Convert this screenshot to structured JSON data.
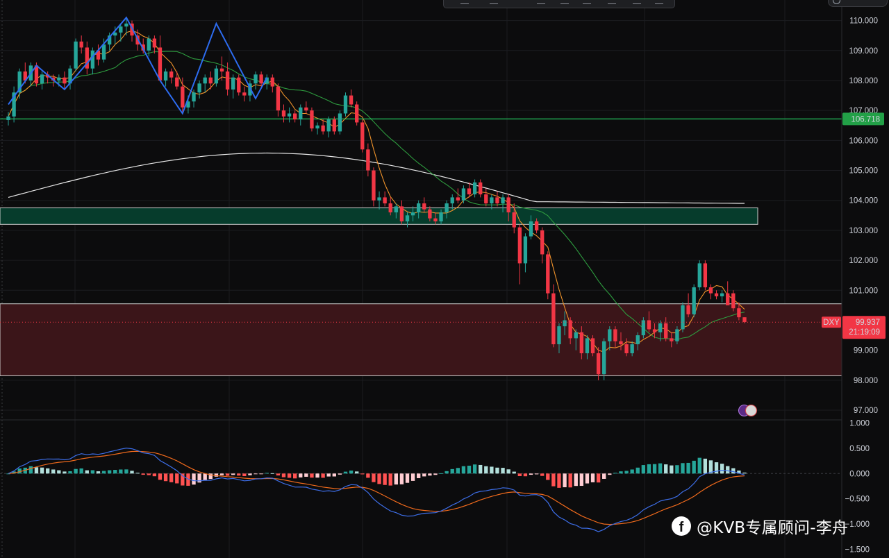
{
  "chart_data": [
    {
      "type": "candlestick",
      "symbol": "DXY",
      "ylim": [
        96.7,
        110.5
      ],
      "y_ticks": [
        "110.000",
        "109.000",
        "108.000",
        "107.000",
        "106.000",
        "105.000",
        "104.000",
        "103.000",
        "102.000",
        "101.000",
        "100.000",
        "99.000",
        "98.000",
        "97.000"
      ],
      "last_price": "99.937",
      "countdown": "21:19:09",
      "horizontal_line": {
        "value": 106.718,
        "label": "106.718",
        "color": "#22c55e"
      },
      "zones": [
        {
          "name": "support-zone",
          "from": 103.2,
          "to": 103.75,
          "fill": "#063c2c",
          "border": "#d0d0d0"
        },
        {
          "name": "resistance-zone",
          "from": 98.15,
          "to": 100.55,
          "fill": "#3b1519",
          "border": "#d0d0d0"
        }
      ],
      "colors": {
        "up": "#26a69a",
        "down": "#f23645",
        "ma_fast": "#f0932b",
        "ma_mid": "#2e9c3f",
        "ma_slow": "#e8e8e8",
        "zigzag": "#2d6cf0"
      },
      "candles": [
        [
          106.68,
          106.95,
          106.5,
          106.8
        ],
        [
          106.8,
          107.8,
          106.6,
          107.6
        ],
        [
          107.6,
          108.4,
          107.4,
          108.3
        ],
        [
          108.3,
          108.6,
          107.9,
          108.0
        ],
        [
          108.0,
          108.6,
          107.8,
          108.5
        ],
        [
          108.5,
          108.6,
          107.8,
          107.9
        ],
        [
          107.9,
          108.3,
          107.7,
          108.2
        ],
        [
          108.2,
          108.3,
          107.9,
          108.1
        ],
        [
          108.1,
          108.2,
          107.8,
          108.0
        ],
        [
          108.0,
          108.2,
          107.8,
          108.1
        ],
        [
          108.1,
          108.3,
          107.7,
          107.9
        ],
        [
          107.9,
          108.5,
          107.7,
          108.4
        ],
        [
          108.4,
          109.4,
          108.3,
          109.3
        ],
        [
          109.3,
          109.5,
          108.9,
          109.1
        ],
        [
          109.1,
          109.3,
          108.2,
          108.4
        ],
        [
          108.4,
          109.1,
          108.2,
          109.0
        ],
        [
          109.0,
          109.2,
          108.5,
          108.7
        ],
        [
          108.7,
          109.4,
          108.6,
          109.2
        ],
        [
          109.2,
          109.6,
          109.0,
          109.5
        ],
        [
          109.5,
          109.8,
          109.2,
          109.6
        ],
        [
          109.6,
          109.9,
          109.3,
          109.8
        ],
        [
          109.8,
          110.1,
          109.5,
          109.9
        ],
        [
          109.9,
          110.0,
          109.3,
          109.5
        ],
        [
          109.5,
          109.7,
          109.0,
          109.2
        ],
        [
          109.2,
          109.4,
          108.9,
          109.0
        ],
        [
          109.0,
          109.5,
          108.8,
          109.4
        ],
        [
          109.4,
          109.5,
          108.9,
          109.1
        ],
        [
          109.1,
          109.5,
          108.0,
          108.0
        ],
        [
          108.0,
          108.4,
          107.8,
          108.3
        ],
        [
          108.3,
          108.4,
          107.9,
          108.1
        ],
        [
          108.1,
          108.3,
          107.7,
          107.8
        ],
        [
          107.8,
          108.1,
          106.9,
          107.1
        ],
        [
          107.1,
          107.5,
          106.9,
          107.3
        ],
        [
          107.3,
          107.7,
          107.1,
          107.6
        ],
        [
          107.6,
          108.0,
          107.4,
          107.9
        ],
        [
          107.9,
          108.2,
          107.6,
          108.1
        ],
        [
          108.1,
          108.3,
          107.7,
          107.9
        ],
        [
          107.9,
          108.5,
          107.8,
          108.4
        ],
        [
          108.4,
          108.8,
          108.0,
          108.3
        ],
        [
          108.3,
          108.6,
          107.5,
          107.7
        ],
        [
          107.7,
          108.2,
          107.4,
          108.1
        ],
        [
          108.1,
          108.2,
          107.5,
          107.6
        ],
        [
          107.6,
          107.8,
          107.3,
          107.5
        ],
        [
          107.5,
          108.0,
          107.3,
          107.9
        ],
        [
          107.9,
          108.3,
          107.7,
          108.2
        ],
        [
          108.2,
          108.3,
          107.8,
          107.9
        ],
        [
          107.9,
          108.2,
          107.7,
          108.1
        ],
        [
          108.1,
          108.2,
          107.6,
          107.8
        ],
        [
          107.8,
          107.9,
          106.8,
          107.0
        ],
        [
          107.0,
          107.2,
          106.6,
          106.8
        ],
        [
          106.8,
          107.1,
          106.6,
          106.9
        ],
        [
          106.9,
          107.0,
          106.6,
          106.7
        ],
        [
          106.7,
          107.2,
          106.5,
          107.1
        ],
        [
          107.1,
          107.3,
          106.9,
          107.0
        ],
        [
          107.0,
          107.1,
          106.3,
          106.4
        ],
        [
          106.4,
          106.6,
          106.2,
          106.5
        ],
        [
          106.5,
          106.7,
          106.2,
          106.3
        ],
        [
          106.3,
          106.8,
          106.1,
          106.7
        ],
        [
          106.7,
          106.8,
          106.2,
          106.3
        ],
        [
          106.3,
          107.0,
          106.2,
          106.9
        ],
        [
          106.9,
          107.6,
          106.8,
          107.5
        ],
        [
          107.5,
          107.7,
          107.1,
          107.2
        ],
        [
          107.2,
          107.3,
          106.5,
          106.6
        ],
        [
          106.6,
          106.7,
          105.6,
          105.7
        ],
        [
          105.7,
          105.9,
          104.8,
          105.0
        ],
        [
          105.0,
          105.1,
          103.8,
          104.0
        ],
        [
          104.0,
          104.3,
          103.7,
          104.1
        ],
        [
          104.1,
          104.3,
          103.8,
          103.9
        ],
        [
          103.9,
          104.1,
          103.5,
          103.6
        ],
        [
          103.6,
          103.9,
          103.4,
          103.8
        ],
        [
          103.8,
          104.0,
          103.2,
          103.3
        ],
        [
          103.3,
          103.6,
          103.1,
          103.5
        ],
        [
          103.5,
          103.8,
          103.3,
          103.6
        ],
        [
          103.6,
          104.0,
          103.4,
          103.9
        ],
        [
          103.9,
          104.1,
          103.6,
          103.7
        ],
        [
          103.7,
          103.8,
          103.3,
          103.4
        ],
        [
          103.4,
          103.6,
          103.2,
          103.3
        ],
        [
          103.3,
          103.7,
          103.2,
          103.6
        ],
        [
          103.6,
          104.0,
          103.4,
          103.9
        ],
        [
          103.9,
          104.2,
          103.7,
          104.1
        ],
        [
          104.1,
          104.4,
          103.9,
          104.0
        ],
        [
          104.0,
          104.5,
          103.9,
          104.4
        ],
        [
          104.4,
          104.6,
          104.1,
          104.2
        ],
        [
          104.2,
          104.7,
          104.1,
          104.6
        ],
        [
          104.6,
          104.7,
          104.1,
          104.2
        ],
        [
          104.2,
          104.4,
          103.8,
          103.9
        ],
        [
          103.9,
          104.2,
          103.7,
          104.1
        ],
        [
          104.1,
          104.3,
          103.8,
          103.9
        ],
        [
          103.9,
          104.2,
          103.6,
          104.1
        ],
        [
          104.1,
          104.2,
          103.3,
          103.6
        ],
        [
          103.6,
          103.9,
          102.9,
          103.1
        ],
        [
          103.1,
          103.2,
          101.2,
          101.9
        ],
        [
          101.9,
          102.9,
          101.6,
          102.8
        ],
        [
          102.8,
          103.5,
          102.7,
          103.3
        ],
        [
          103.3,
          103.4,
          102.9,
          103.0
        ],
        [
          103.0,
          103.1,
          101.9,
          102.2
        ],
        [
          102.2,
          102.3,
          100.7,
          100.9
        ],
        [
          100.9,
          101.2,
          99.1,
          99.2
        ],
        [
          99.2,
          99.9,
          98.9,
          99.8
        ],
        [
          99.8,
          100.3,
          99.5,
          100.0
        ],
        [
          100.0,
          100.1,
          99.2,
          99.4
        ],
        [
          99.4,
          99.7,
          99.0,
          99.6
        ],
        [
          99.6,
          99.8,
          98.7,
          98.9
        ],
        [
          98.9,
          99.5,
          98.7,
          99.4
        ],
        [
          99.4,
          99.5,
          98.8,
          98.9
        ],
        [
          98.9,
          99.1,
          98.0,
          98.2
        ],
        [
          98.2,
          99.4,
          98.0,
          99.3
        ],
        [
          99.3,
          99.8,
          99.0,
          99.7
        ],
        [
          99.7,
          99.8,
          99.1,
          99.3
        ],
        [
          99.3,
          99.6,
          99.0,
          99.2
        ],
        [
          99.2,
          99.4,
          98.8,
          98.9
        ],
        [
          98.9,
          99.3,
          98.8,
          99.2
        ],
        [
          99.2,
          99.6,
          99.0,
          99.5
        ],
        [
          99.5,
          100.1,
          99.4,
          100.0
        ],
        [
          100.0,
          100.3,
          99.6,
          99.7
        ],
        [
          99.7,
          99.9,
          99.4,
          99.6
        ],
        [
          99.6,
          100.0,
          99.3,
          99.9
        ],
        [
          99.9,
          100.1,
          99.3,
          99.4
        ],
        [
          99.4,
          99.6,
          99.1,
          99.3
        ],
        [
          99.3,
          99.8,
          99.2,
          99.7
        ],
        [
          99.7,
          100.6,
          99.6,
          100.5
        ],
        [
          100.5,
          100.9,
          100.1,
          100.2
        ],
        [
          100.2,
          101.2,
          100.1,
          101.1
        ],
        [
          101.1,
          102.0,
          101.0,
          101.9
        ],
        [
          101.9,
          102.0,
          101.0,
          101.1
        ],
        [
          101.1,
          101.2,
          100.7,
          100.9
        ],
        [
          100.9,
          101.0,
          100.7,
          100.8
        ],
        [
          100.8,
          101.0,
          100.6,
          100.9
        ],
        [
          100.9,
          101.3,
          100.6,
          100.5
        ],
        [
          100.9,
          101.0,
          100.3,
          100.4
        ],
        [
          100.4,
          100.6,
          100.0,
          100.1
        ],
        [
          100.1,
          100.1,
          99.9,
          99.94
        ]
      ],
      "indicator_panel": {
        "type": "macd",
        "ylim": [
          -1.62,
          1.05
        ],
        "y_ticks": [
          "1.000",
          "0.500",
          "0.000",
          "−0.500",
          "−1.000",
          "−1.500"
        ],
        "colors": {
          "macd": "#3d6ee8",
          "signal": "#f06a1c",
          "hist_up_strong": "#26a69a",
          "hist_up_weak": "#b2dfdb",
          "hist_down_strong": "#ff5252",
          "hist_down_weak": "#ffcdd2"
        }
      }
    }
  ],
  "watermark": {
    "platform_icon": "facebook-icon",
    "text": "@KVB专属顾问-李舟"
  }
}
